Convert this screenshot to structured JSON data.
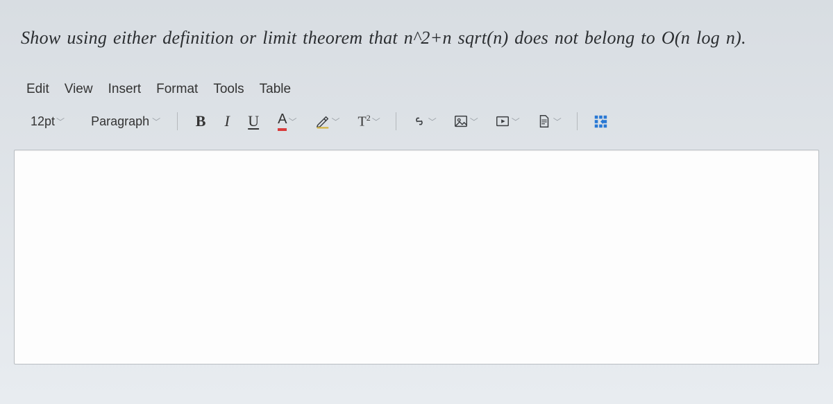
{
  "prompt": "Show using either definition or limit theorem that   n^2+n sqrt(n)    does not belong to  O(n log n).",
  "menubar": {
    "items": [
      "Edit",
      "View",
      "Insert",
      "Format",
      "Tools",
      "Table"
    ]
  },
  "toolbar": {
    "fontSize": "12pt",
    "blockFormat": "Paragraph",
    "bold": "B",
    "italic": "I",
    "underline": "U",
    "textColorLetter": "A",
    "superscriptLabel": "T",
    "superscriptExp": "2"
  }
}
